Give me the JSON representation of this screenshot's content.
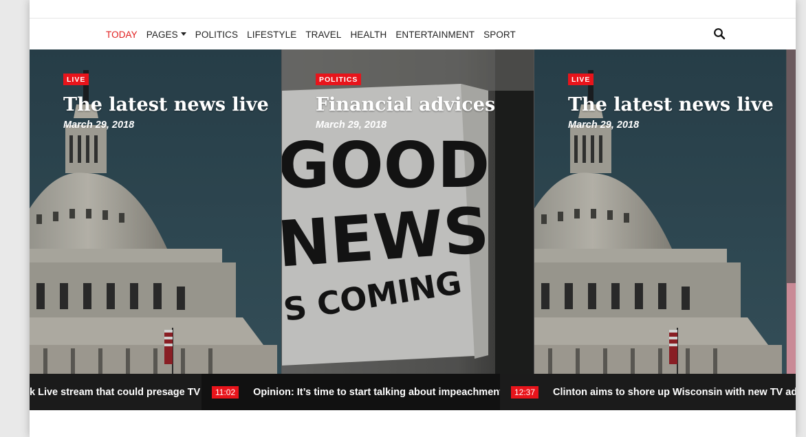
{
  "nav": {
    "items": [
      {
        "label": "TODAY",
        "active": true
      },
      {
        "label": "PAGES",
        "dropdown": true
      },
      {
        "label": "POLITICS"
      },
      {
        "label": "LIFESTYLE"
      },
      {
        "label": "TRAVEL"
      },
      {
        "label": "HEALTH"
      },
      {
        "label": "ENTERTAINMENT"
      },
      {
        "label": "SPORT"
      }
    ],
    "search_icon": "search-icon"
  },
  "slides": [
    {
      "badge": "LIVE",
      "title": "The latest news live",
      "date": "March 29, 2018",
      "image": "capitol-dome"
    },
    {
      "badge": "POLITICS",
      "title": "Financial advices",
      "date": "March 29, 2018",
      "image": "good-news-poster",
      "poster_lines": [
        "GOOD",
        "NEWS",
        "S COMING"
      ]
    },
    {
      "badge": "LIVE",
      "title": "The latest news live",
      "date": "March 29, 2018",
      "image": "capitol-dome"
    }
  ],
  "ticker": {
    "items": [
      {
        "time": "",
        "text": "k Live stream that could presage TV"
      },
      {
        "time": "11:02",
        "text": "Opinion: It’s time to start talking about impeachment"
      },
      {
        "time": "12:37",
        "text": "Clinton aims to shore up Wisconsin with new TV ads"
      }
    ]
  },
  "colors": {
    "accent": "#e8141b",
    "ticker_bg": "#111111",
    "sky": "#34525e"
  }
}
